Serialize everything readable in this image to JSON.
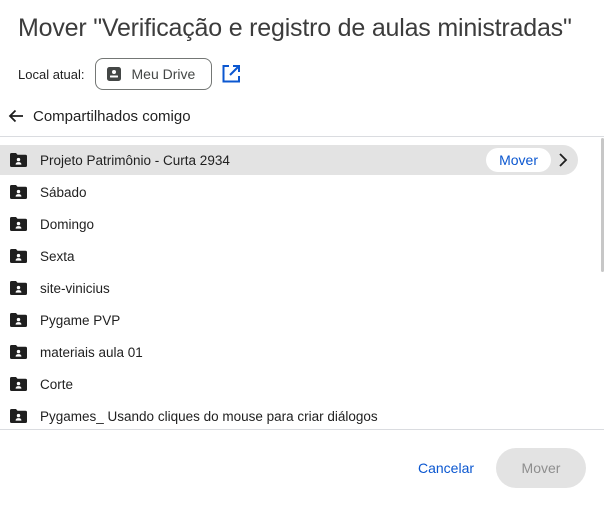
{
  "dialog": {
    "title": "Mover \"Verificação e registro de aulas ministradas\""
  },
  "location": {
    "label": "Local atual:",
    "current": "Meu Drive",
    "drive_icon": "drive-icon",
    "open_icon": "open-in-new-icon"
  },
  "navigation": {
    "back_icon": "arrow-back-icon",
    "current_folder": "Compartilhados comigo"
  },
  "folders": [
    {
      "name": "Projeto Patrimônio - Curta 2934",
      "selected": true
    },
    {
      "name": "Sábado"
    },
    {
      "name": "Domingo"
    },
    {
      "name": "Sexta"
    },
    {
      "name": "site-vinicius"
    },
    {
      "name": "Pygame PVP"
    },
    {
      "name": "materiais aula 01"
    },
    {
      "name": "Corte"
    },
    {
      "name": "Pygames_ Usando cliques do mouse para criar diálogos"
    }
  ],
  "row_actions": {
    "move_label": "Mover",
    "chevron_icon": "chevron-right-icon"
  },
  "footer": {
    "cancel_label": "Cancelar",
    "move_label": "Mover"
  },
  "colors": {
    "accent": "#0b57d0",
    "selected_row": "#e3e3e3",
    "disabled_button": "#e3e3e3",
    "folder_icon": "#1f1f1f"
  }
}
